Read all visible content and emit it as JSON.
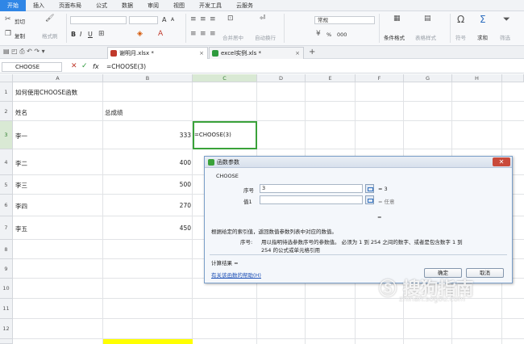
{
  "menu": {
    "tabs": [
      "开始",
      "插入",
      "页面布局",
      "公式",
      "数据",
      "审阅",
      "视图",
      "开发工具",
      "云服务"
    ]
  },
  "ribbon": {
    "cut": "剪切",
    "copy": "复制",
    "format_painter": "格式刷",
    "bold": "B",
    "italic": "I",
    "underline": "U",
    "font_grow": "A",
    "merge_center": "合并居中",
    "wrap_text": "自动换行",
    "number_format": "常规",
    "percent": "%",
    "thousands": "000",
    "conditional_format": "条件格式",
    "table_style": "表格样式",
    "symbol": "符号",
    "sum": "求和",
    "filter": "筛选"
  },
  "doc_tabs": [
    {
      "name": "谢明月.xlsx *",
      "color": "#c0392b"
    },
    {
      "name": "excel实例.xls *",
      "color": "#2e9a3d"
    }
  ],
  "formula_bar": {
    "name_box": "CHOOSE",
    "cancel": "✕",
    "confirm": "✓",
    "fx": "fx",
    "content": "=CHOOSE(3)"
  },
  "columns": [
    "A",
    "B",
    "C",
    "D",
    "E",
    "F",
    "G",
    "H"
  ],
  "rows": [
    "1",
    "2",
    "3",
    "4",
    "5",
    "6",
    "7",
    "8",
    "9",
    "10",
    "11",
    "12"
  ],
  "cells": {
    "a1": "如何使用CHOOSE函数",
    "a2": "姓名",
    "b2": "总成绩",
    "a3": "李一",
    "b3": "333",
    "c3": "=CHOOSE(3)",
    "a4": "李二",
    "b4": "400",
    "a5": "李三",
    "b5": "500",
    "a6": "李四",
    "b6": "270",
    "a7": "李五",
    "b7": "450"
  },
  "dialog": {
    "title": "函数参数",
    "function_name": "CHOOSE",
    "arg1_label": "序号",
    "arg1_value": "3",
    "arg1_result": "= 3",
    "arg2_label": "值1",
    "arg2_value": "",
    "arg2_result": "= 任意",
    "result_eq": "=",
    "description": "根据给定的索引值，返回数值参数列表中对应的数值。",
    "param_label": "序号:",
    "param_desc_line1": "用以指明待选参数序号的参数值。 必须为 1 到 254 之间的数字、或者是包含数字 1 到",
    "param_desc_line2": "254 的公式或单元格引用",
    "calc_result": "计算结果 =",
    "help_link": "有关该函数的帮助(H)",
    "ok": "确定",
    "cancel": "取消",
    "close": "✕"
  }
}
